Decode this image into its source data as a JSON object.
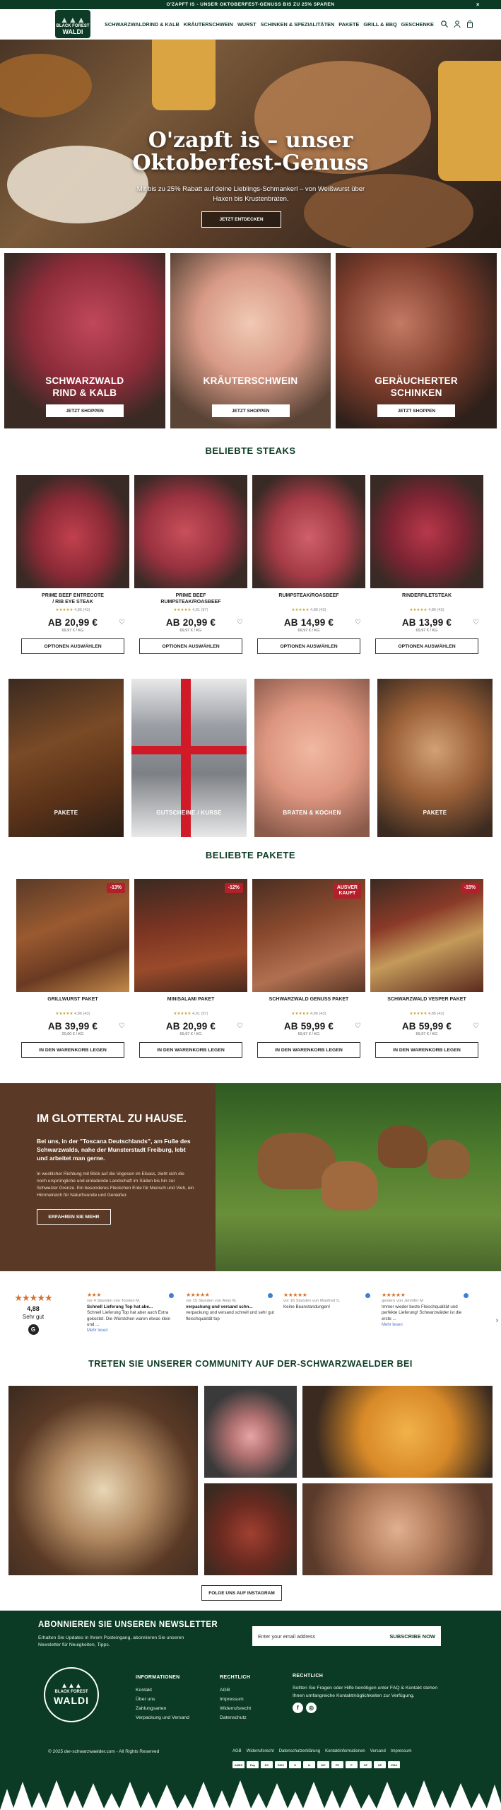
{
  "announcement": {
    "text": "O'ZAPFT IS - UNSER OKTOBERFEST-GENUSS BIS ZU 25% SPAREN",
    "close": "×"
  },
  "header": {
    "logo_line1": "BLACK FOREST",
    "logo_line2": "WALDI",
    "nav": [
      "SCHWARZWALDRIND & KALB",
      "KRÄUTERSCHWEIN",
      "WURST",
      "SCHINKEN & SPEZIALITÄTEN",
      "PAKETE",
      "GRILL & BBQ",
      "GESCHENKE"
    ],
    "icons": [
      "search-icon",
      "account-icon",
      "cart-icon"
    ]
  },
  "hero": {
    "title_line1": "O'zapft is – unser",
    "title_line2": "Oktoberfest-Genuss",
    "text": "Mit bis zu 25% Rabatt auf deine Lieblings-Schmankerl – von Weißwurst über Haxen bis Krustenbraten.",
    "button": "JETZT ENTDECKEN"
  },
  "categories": [
    {
      "title": "SCHWARZWALD\nRIND & KALB",
      "button": "JETZT SHOPPEN"
    },
    {
      "title": "KRÄUTERSCHWEIN",
      "button": "JETZT SHOPPEN"
    },
    {
      "title": "GERÄUCHERTER\nSCHINKEN",
      "button": "JETZT SHOPPEN"
    }
  ],
  "steaks": {
    "title": "BELIEBTE STEAKS",
    "items": [
      {
        "name": "PRIME BEEF ENTRECOTE\n/ RIB EYE STEAK",
        "stars": "★★★★★",
        "rating": "4,86 (43)",
        "price": "AB 20,99 €",
        "unit": "69,97 € / KG",
        "button": "OPTIONEN AUSWÄHLEN"
      },
      {
        "name": "PRIME BEEF\nRUMPSTEAK/ROASBEEF",
        "stars": "★★★★★",
        "rating": "4,91 (97)",
        "price": "AB 20,99 €",
        "unit": "69,97 € / KG",
        "button": "OPTIONEN AUSWÄHLEN"
      },
      {
        "name": "RUMPSTEAK/ROASBEEF",
        "stars": "★★★★★",
        "rating": "4,86 (43)",
        "price": "AB 14,99 €",
        "unit": "69,97 € / KG",
        "button": "OPTIONEN AUSWÄHLEN"
      },
      {
        "name": "RINDERFILETSTEAK",
        "stars": "★★★★★",
        "rating": "4,86 (43)",
        "price": "AB 13,99 €",
        "unit": "69,97 € / KG",
        "button": "OPTIONEN AUSWÄHLEN"
      }
    ]
  },
  "tiles": [
    {
      "label": "PAKETE"
    },
    {
      "label": "GUTSCHEINE / KURSE"
    },
    {
      "label": "BRATEN & KOCHEN"
    },
    {
      "label": "PAKETE"
    }
  ],
  "packages": {
    "title": "BELIEBTE PAKETE",
    "items": [
      {
        "badge": "-13%",
        "name": "GRILLWURST PAKET",
        "stars": "★★★★★",
        "rating": "4,86 (43)",
        "price": "AB 39,99 €",
        "unit": "20,00 € / KG",
        "button": "IN DEN WARENKORB LEGEN"
      },
      {
        "badge": "-12%",
        "name": "MINISALAMI PAKET",
        "stars": "★★★★★",
        "rating": "4,91 (97)",
        "price": "AB 20,99 €",
        "unit": "69,97 € / KG",
        "button": "IN DEN WARENKORB LEGEN"
      },
      {
        "badge": "AUSVER\nKAUFT",
        "name": "SCHWARZWALD GENUSS PAKET",
        "stars": "★★★★★",
        "rating": "4,86 (43)",
        "price": "AB 59,99 €",
        "unit": "69,97 € / KG",
        "button": "IN DEN WARENKORB LEGEN"
      },
      {
        "badge": "-15%",
        "name": "SCHWARZWALD VESPER PAKET",
        "stars": "★★★★★",
        "rating": "4,86 (43)",
        "price": "AB 59,99 €",
        "unit": "69,97 € / KG",
        "button": "IN DEN WARENKORB LEGEN"
      }
    ]
  },
  "about": {
    "title": "IM GLOTTERTAL ZU HAUSE.",
    "bold": "Bei uns, in der \"Toscana Deutschlands\", am Fuße des Schwarzwalds, nahe der Munsterstadt Freiburg, lebt und arbeitet man gerne.",
    "text": "In westlicher Richtung mit Blick auf die Vogesen im Elsass, zieht sich die noch ursprüngliche und einladende Landschaft im Süden bis hin zur Schweizer Grenze. Ein besonderes Fleckchen Erde für Mensch und Vieh, ein Himmelreich für Naturfreunde und Genießer.",
    "button": "ERFAHREN SIE MEHR"
  },
  "reviews": {
    "summary_stars": "★★★★★",
    "score": "4,88",
    "label": "Sehr gut",
    "items": [
      {
        "stars": "★★★",
        "meta": "vor 4 Stunden von Torsten M.",
        "title": "Schnell Lieferung Top hat abe...",
        "text": "Schnell Lieferung Top hat aber auch Extra gekostet. Die Würstchen waren etwas klein und ...",
        "more": "Mehr lesen"
      },
      {
        "stars": "★★★★★",
        "meta": "vor 15 Stunden von Alois M.",
        "title": "verpackung und versand schn...",
        "text": "verpackung und versand schnell und sehr gut fleischqualität top",
        "more": ""
      },
      {
        "stars": "★★★★★",
        "meta": "vor 16 Stunden von Manfred S.",
        "title": "Keine Beanstandungen!",
        "text": "",
        "more": ""
      },
      {
        "stars": "★★★★★",
        "meta": "gestern von Jennifer M",
        "title": "",
        "text": "Immer wieder beste Fleischqualität und perfekte Lieferung! Schwarzwälder ist die erste ...",
        "more": "Mehr lesen"
      }
    ]
  },
  "community": {
    "title": "TRETEN SIE UNSERER COMMUNITY AUF DER-SCHWARZWAELDER BEI",
    "button": "FOLGE UNS AUF INSTAGRAM"
  },
  "footer": {
    "newsletter_title": "ABONNIEREN SIE UNSEREN NEWSLETTER",
    "newsletter_text": "Erhalten Sie Updates in Ihrem Posteingang, abonnieren Sie unseren Newsletter für Neuigkeiten, Tipps.",
    "email_placeholder": "Enter your email address",
    "subscribe": "SUBSCRIBE NOW",
    "logo_line1": "BLACK FOREST",
    "logo_line2": "WALDI",
    "info_title": "INFORMATIONEN",
    "info_links": [
      "Kontakt",
      "Über uns",
      "Zahlungsarten",
      "Verpackung und Versand"
    ],
    "legal_title": "RECHTLICH",
    "legal_links": [
      "AGB",
      "Impressum",
      "Widerrufsrecht",
      "Datenschutz"
    ],
    "help_title": "RECHTLICH",
    "help_text": "Sollten Sie Fragen oder Hilfe benötigen unter FAQ & Kontakt stehen Ihnen umfangreiche Kontaktmöglichkeiten zur Verfügung.",
    "copyright": "© 2025 der-schwarzwaelder.com - All Rights Reserved",
    "bottom_links": [
      "AGB",
      "Widerrufsrecht",
      "Datenschutzerklärung",
      "Kontaktinformationen",
      "Versand",
      "Impressum"
    ],
    "payments": [
      "AMEX",
      "Pay",
      "DC",
      "DISC",
      "G",
      "kl",
      "MC",
      "PP",
      "P",
      "SP",
      "UP",
      "VISA"
    ]
  },
  "colors": {
    "brand_green": "#0b3b25",
    "sale_red": "#b3202a",
    "star_gold": "#c9a227",
    "about_brown": "#5a3a26"
  }
}
